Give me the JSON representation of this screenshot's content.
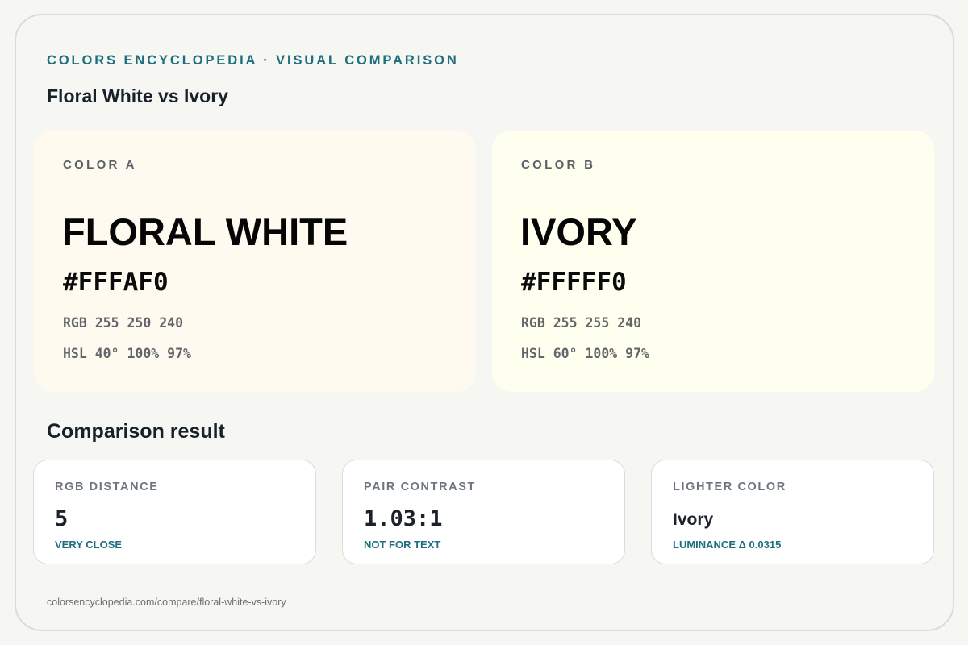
{
  "header": {
    "eyebrow": "COLORS ENCYCLOPEDIA · VISUAL COMPARISON",
    "title": "Floral White vs Ivory"
  },
  "colors": {
    "a": {
      "label": "COLOR A",
      "name": "FLORAL WHITE",
      "hex": "#FFFAF0",
      "rgb": "RGB 255 250 240",
      "hsl": "HSL 40° 100% 97%",
      "swatch": "#FFFAF0"
    },
    "b": {
      "label": "COLOR B",
      "name": "IVORY",
      "hex": "#FFFFF0",
      "rgb": "RGB 255 255 240",
      "hsl": "HSL 60° 100% 97%",
      "swatch": "#FFFFF0"
    }
  },
  "comparison": {
    "title": "Comparison result",
    "metrics": [
      {
        "label": "RGB DISTANCE",
        "value": "5",
        "note": "VERY CLOSE"
      },
      {
        "label": "PAIR CONTRAST",
        "value": "1.03:1",
        "note": "NOT FOR TEXT"
      },
      {
        "label": "LIGHTER COLOR",
        "value": "Ivory",
        "note": "LUMINANCE Δ 0.0315"
      }
    ]
  },
  "footer": {
    "url": "colorsencyclopedia.com/compare/floral-white-vs-ivory"
  },
  "theme": {
    "accent": "#1D6F7F",
    "page_background": "#F6F6F2",
    "card_border": "#DADCDF"
  }
}
